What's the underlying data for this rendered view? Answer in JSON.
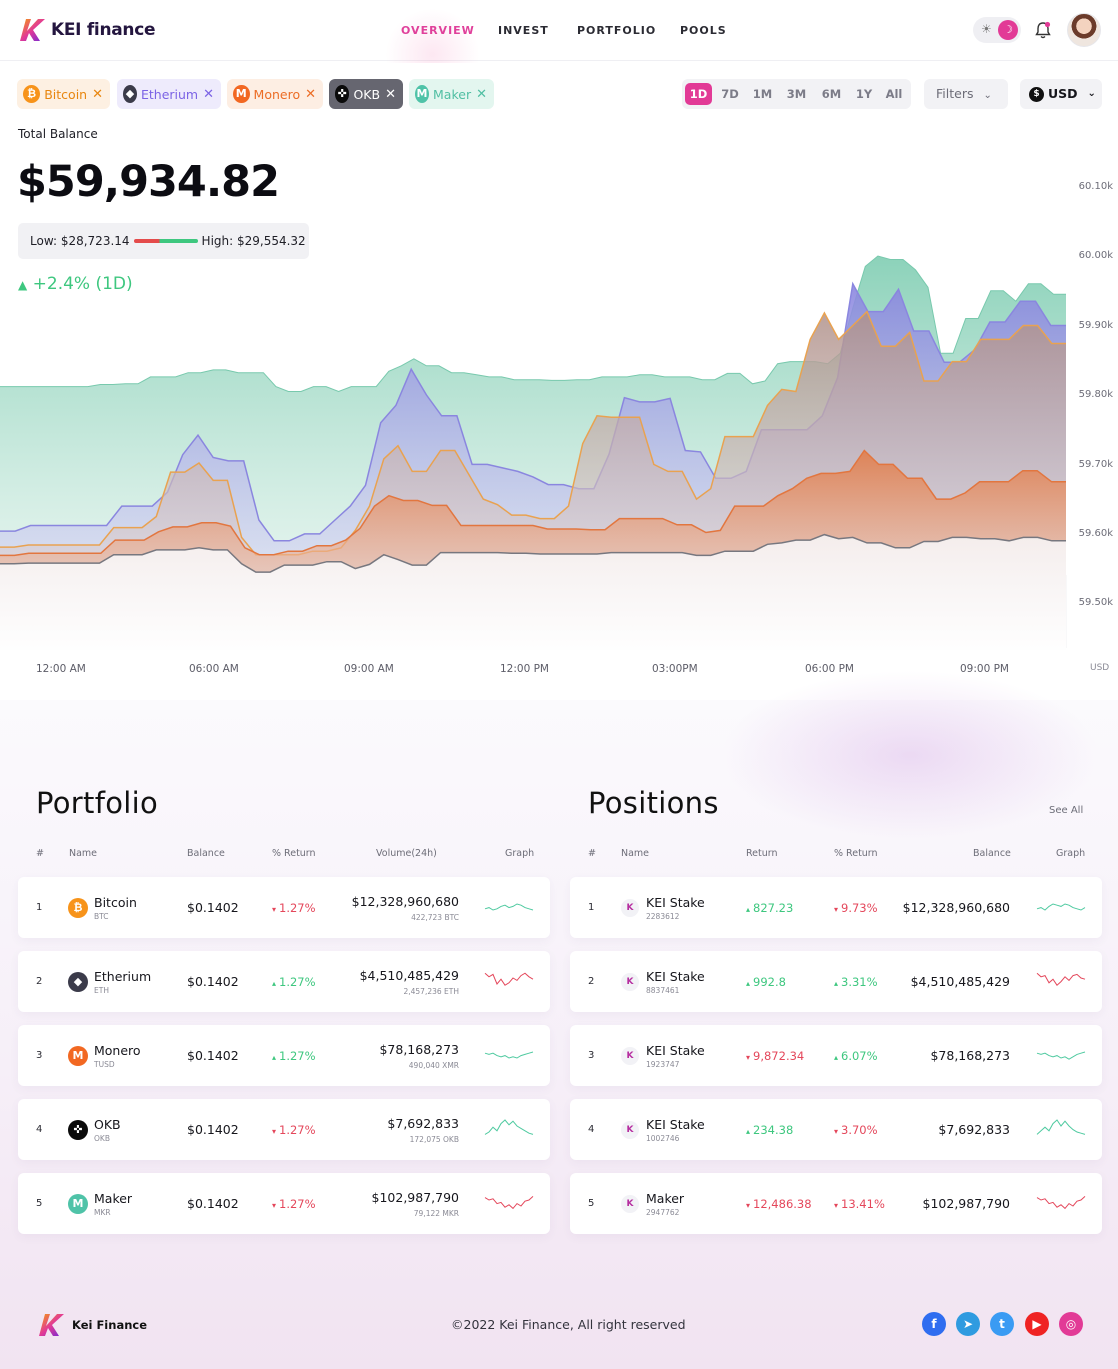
{
  "brand": {
    "name": "KEI finance",
    "footer_name": "Kei Finance"
  },
  "nav": {
    "items": [
      "OVERVIEW",
      "INVEST",
      "PORTFOLIO",
      "POOLS"
    ],
    "active": "OVERVIEW"
  },
  "header": {
    "theme_sun_icon": "☀",
    "theme_moon_icon": "☽"
  },
  "chips": [
    {
      "label": "Bitcoin",
      "icon": "bitcoin-icon",
      "glyph": "₿",
      "color": "#f7931a",
      "bg": "#fdf0e2",
      "text": "#e8860f"
    },
    {
      "label": "Etherium",
      "icon": "ethereum-icon",
      "glyph": "◆",
      "color": "#3b3b4a",
      "bg": "#eeebfc",
      "text": "#7b63e5"
    },
    {
      "label": "Monero",
      "icon": "monero-icon",
      "glyph": "M",
      "color": "#f26822",
      "bg": "#fdeee3",
      "text": "#ec6d26"
    },
    {
      "label": "OKB",
      "icon": "okb-icon",
      "glyph": "✜",
      "color": "#0b0b0b",
      "bg": "#666670",
      "text": "#ffffff"
    },
    {
      "label": "Maker",
      "icon": "maker-icon",
      "glyph": "M",
      "color": "#4fc3a8",
      "bg": "#e3f6ef",
      "text": "#50bfa3"
    }
  ],
  "timeframes": [
    "1D",
    "7D",
    "1M",
    "3M",
    "6M",
    "1Y",
    "All"
  ],
  "timeframe_active": "1D",
  "filters_label": "Filters",
  "currency_label": "USD",
  "currency_symbol": "$",
  "total_balance_label": "Total Balance",
  "total_balance": "$59,934.82",
  "low_label": "Low: $28,723.14",
  "high_label": "High: $29,554.32",
  "change": "+2.4% (1D)",
  "change_arrow": "▲",
  "colors": {
    "accent": "#e23a96",
    "positive": "#3ec77f",
    "negative": "#e4475b"
  },
  "chart_data": {
    "type": "area",
    "y_ticks": [
      "60.10k",
      "60.00k",
      "59.90k",
      "59.80k",
      "59.70k",
      "59.60k",
      "59.50k"
    ],
    "x_ticks": [
      "12:00 AM",
      "06:00 AM",
      "09:00 AM",
      "12:00 PM",
      "03:00PM",
      "06:00 PM",
      "09:00 PM"
    ],
    "unit_label": "USD",
    "ylim": [
      59500,
      60100
    ],
    "grid": true,
    "series": [
      {
        "color": "#7fcdb2",
        "values": [
          59812,
          59812,
          59812,
          59812,
          59812,
          59812,
          59812,
          59812,
          59815,
          59815,
          59816,
          59816,
          59826,
          59826,
          59826,
          59832,
          59832,
          59836,
          59836,
          59832,
          59832,
          59832,
          59812,
          59805,
          59805,
          59812,
          59812,
          59805,
          59812,
          59812,
          59812,
          59834,
          59842,
          59852,
          59842,
          59842,
          59832,
          59832,
          59829,
          59826,
          59826,
          59822,
          59822,
          59822,
          59821,
          59821,
          59822,
          59822,
          59826,
          59826,
          59826,
          59829,
          59829,
          59826,
          59826,
          59826,
          59822,
          59822,
          59831,
          59831,
          59816,
          59820,
          59845,
          59848,
          59848,
          59848,
          59845,
          59860,
          59925,
          59985,
          60000,
          59995,
          59995,
          59980,
          59955,
          59860,
          59860,
          59910,
          59910,
          59950,
          59950,
          59935,
          59960,
          59960,
          59945,
          59945
        ]
      },
      {
        "color": "#8a86df",
        "values": [
          59604,
          59604,
          59612,
          59612,
          59612,
          59612,
          59612,
          59612,
          59640,
          59640,
          59640,
          59660,
          59714,
          59742,
          59710,
          59705,
          59705,
          59620,
          59590,
          59590,
          59600,
          59600,
          59620,
          59640,
          59670,
          59760,
          59785,
          59837,
          59800,
          59770,
          59770,
          59700,
          59700,
          59695,
          59690,
          59682,
          59671,
          59671,
          59665,
          59665,
          59715,
          59796,
          59790,
          59790,
          59795,
          59720,
          59718,
          59680,
          59680,
          59690,
          59750,
          59750,
          59750,
          59750,
          59770,
          59825,
          59960,
          59920,
          59920,
          59952,
          59892,
          59892,
          59847,
          59847,
          59865,
          59905,
          59905,
          59935,
          59935,
          59900,
          59900
        ]
      },
      {
        "color": "#e9a250",
        "values": [
          59581,
          59581,
          59584,
          59584,
          59584,
          59584,
          59584,
          59584,
          59609,
          59609,
          59609,
          59625,
          59689,
          59689,
          59702,
          59677,
          59677,
          59595,
          59570,
          59570,
          59570,
          59570,
          59575,
          59575,
          59580,
          59605,
          59640,
          59708,
          59727,
          59690,
          59690,
          59720,
          59720,
          59685,
          59650,
          59642,
          59627,
          59627,
          59622,
          59622,
          59640,
          59730,
          59770,
          59768,
          59768,
          59768,
          59700,
          59690,
          59690,
          59650,
          59665,
          59740,
          59740,
          59740,
          59785,
          59808,
          59805,
          59880,
          59918,
          59880,
          59900,
          59920,
          59870,
          59870,
          59890,
          59820,
          59820,
          59848,
          59848,
          59880,
          59880,
          59880,
          59900,
          59900,
          59874,
          59874
        ]
      },
      {
        "color": "#e2763f",
        "values": [
          59569,
          59569,
          59572,
          59572,
          59572,
          59572,
          59572,
          59572,
          59591,
          59591,
          59591,
          59603,
          59610,
          59610,
          59616,
          59616,
          59611,
          59580,
          59570,
          59570,
          59575,
          59575,
          59583,
          59583,
          59591,
          59608,
          59640,
          59655,
          59648,
          59648,
          59641,
          59641,
          59612,
          59612,
          59612,
          59612,
          59612,
          59612,
          59607,
          59607,
          59607,
          59606,
          59606,
          59622,
          59622,
          59622,
          59622,
          59613,
          59613,
          59602,
          59605,
          59640,
          59640,
          59640,
          59655,
          59665,
          59680,
          59687,
          59687,
          59690,
          59720,
          59700,
          59700,
          59680,
          59680,
          59650,
          59650,
          59659,
          59675,
          59675,
          59675,
          59691,
          59691,
          59675,
          59675
        ]
      },
      {
        "color": "#77777f",
        "values": [
          59557,
          59557,
          59558,
          59558,
          59558,
          59558,
          59558,
          59558,
          59570,
          59570,
          59570,
          59577,
          59577,
          59577,
          59580,
          59577,
          59577,
          59557,
          59545,
          59545,
          59555,
          59555,
          59555,
          59560,
          59560,
          59550,
          59556,
          59570,
          59563,
          59555,
          59555,
          59573,
          59573,
          59573,
          59573,
          59573,
          59572,
          59572,
          59571,
          59571,
          59571,
          59571,
          59571,
          59573,
          59573,
          59573,
          59573,
          59573,
          59573,
          59569,
          59569,
          59575,
          59575,
          59575,
          59585,
          59587,
          59591,
          59591,
          59599,
          59593,
          59595,
          59587,
          59587,
          59580,
          59580,
          59589,
          59589,
          59595,
          59595,
          59593,
          59593,
          59590,
          59595,
          59595,
          59590,
          59590
        ]
      }
    ]
  },
  "portfolio": {
    "title": "Portfolio",
    "headers": [
      "#",
      "Name",
      "Balance",
      "% Return",
      "Volume(24h)",
      "Graph"
    ],
    "rows": [
      {
        "idx": "1",
        "name": "Bitcoin",
        "sym": "BTC",
        "icon": "bitcoin-icon",
        "glyph": "₿",
        "color": "#f7931a",
        "balance": "$0.1402",
        "ret_arrow": "▾",
        "ret": "1.27%",
        "ret_dir": "neg",
        "volume": "$12,328,960,680",
        "vol_sub": "422,723 BTC",
        "spark_color": "#4fcaa0",
        "spark": [
          6,
          7,
          5,
          6,
          8,
          9,
          7,
          8,
          10,
          9,
          7,
          6,
          5
        ]
      },
      {
        "idx": "2",
        "name": "Etherium",
        "sym": "ETH",
        "icon": "ethereum-icon",
        "glyph": "◆",
        "color": "#3b3b4a",
        "balance": "$0.1402",
        "ret_arrow": "▴",
        "ret": "1.27%",
        "ret_dir": "pos",
        "volume": "$4,510,485,429",
        "vol_sub": "2,457,236 ETH",
        "spark_color": "#e4475b",
        "spark": [
          14,
          11,
          13,
          5,
          9,
          4,
          6,
          10,
          8,
          12,
          14,
          11,
          9
        ]
      },
      {
        "idx": "3",
        "name": "Monero",
        "sym": "TUSD",
        "icon": "monero-icon",
        "glyph": "M",
        "color": "#f26822",
        "balance": "$0.1402",
        "ret_arrow": "▴",
        "ret": "1.27%",
        "ret_dir": "pos",
        "volume": "$78,168,273",
        "vol_sub": "490,040 XMR",
        "spark_color": "#4fcaa0",
        "spark": [
          9,
          8,
          9,
          7,
          6,
          7,
          5,
          6,
          5,
          7,
          8,
          9,
          10
        ]
      },
      {
        "idx": "4",
        "name": "OKB",
        "sym": "OKB",
        "icon": "okb-icon",
        "glyph": "✜",
        "color": "#0b0b0b",
        "balance": "$0.1402",
        "ret_arrow": "▾",
        "ret": "1.27%",
        "ret_dir": "neg",
        "volume": "$7,692,833",
        "vol_sub": "172,075 OKB",
        "spark_color": "#4fcaa0",
        "spark": [
          3,
          5,
          9,
          6,
          12,
          15,
          11,
          14,
          10,
          8,
          6,
          4,
          3
        ]
      },
      {
        "idx": "5",
        "name": "Maker",
        "sym": "MKR",
        "icon": "maker-icon",
        "glyph": "M",
        "color": "#4fc3a8",
        "balance": "$0.1402",
        "ret_arrow": "▾",
        "ret": "1.27%",
        "ret_dir": "neg",
        "volume": "$102,987,790",
        "vol_sub": "79,122 MKR",
        "spark_color": "#e4475b",
        "spark": [
          12,
          10,
          11,
          7,
          8,
          4,
          6,
          3,
          7,
          5,
          9,
          10,
          13
        ]
      }
    ]
  },
  "positions": {
    "title": "Positions",
    "see_all": "See All",
    "headers": [
      "#",
      "Name",
      "Return",
      "% Return",
      "Balance",
      "Graph"
    ],
    "rows": [
      {
        "idx": "1",
        "name": "KEI Stake",
        "id": "2283612",
        "ret_arrow": "▴",
        "ret": "827.23",
        "ret_dir": "pos",
        "pret_arrow": "▾",
        "pret": "9.73%",
        "pret_dir": "neg",
        "balance": "$12,328,960,680",
        "spark_color": "#4fcaa0",
        "spark": [
          6,
          7,
          5,
          8,
          10,
          9,
          8,
          10,
          9,
          7,
          6,
          5,
          7
        ]
      },
      {
        "idx": "2",
        "name": "KEI Stake",
        "id": "8837461",
        "ret_arrow": "▴",
        "ret": "992.8",
        "ret_dir": "pos",
        "pret_arrow": "▴",
        "pret": "3.31%",
        "pret_dir": "pos",
        "balance": "$4,510,485,429",
        "spark_color": "#e4475b",
        "spark": [
          14,
          11,
          12,
          6,
          9,
          4,
          7,
          11,
          8,
          12,
          13,
          10,
          9
        ]
      },
      {
        "idx": "3",
        "name": "KEI Stake",
        "id": "1923747",
        "ret_arrow": "▾",
        "ret": "9,872.34",
        "ret_dir": "neg",
        "pret_arrow": "▴",
        "pret": "6.07%",
        "pret_dir": "pos",
        "balance": "$78,168,273",
        "spark_color": "#4fcaa0",
        "spark": [
          9,
          8,
          9,
          7,
          6,
          7,
          5,
          6,
          4,
          6,
          8,
          9,
          10
        ]
      },
      {
        "idx": "4",
        "name": "KEI Stake",
        "id": "1002746",
        "ret_arrow": "▴",
        "ret": "234.38",
        "ret_dir": "pos",
        "pret_arrow": "▾",
        "pret": "3.70%",
        "pret_dir": "neg",
        "balance": "$7,692,833",
        "spark_color": "#4fcaa0",
        "spark": [
          3,
          6,
          9,
          6,
          12,
          15,
          10,
          14,
          10,
          7,
          5,
          4,
          3
        ]
      },
      {
        "idx": "5",
        "name": "Maker",
        "id": "2947762",
        "ret_arrow": "▾",
        "ret": "12,486.38",
        "ret_dir": "neg",
        "pret_arrow": "▾",
        "pret": "13.41%",
        "pret_dir": "neg",
        "balance": "$102,987,790",
        "spark_color": "#e4475b",
        "spark": [
          12,
          10,
          11,
          7,
          8,
          4,
          6,
          3,
          7,
          5,
          9,
          10,
          13
        ]
      }
    ]
  },
  "footer": {
    "copyright": "©2022 Kei Finance, All right reserved",
    "social": [
      {
        "icon": "facebook-icon",
        "glyph": "f",
        "color": "#2f6df0"
      },
      {
        "icon": "telegram-icon",
        "glyph": "➤",
        "color": "#2f9be0"
      },
      {
        "icon": "twitter-icon",
        "glyph": "t",
        "color": "#3a9bf3"
      },
      {
        "icon": "youtube-icon",
        "glyph": "▶",
        "color": "#ef2323"
      },
      {
        "icon": "instagram-icon",
        "glyph": "◎",
        "color": "#e23a96"
      }
    ]
  }
}
